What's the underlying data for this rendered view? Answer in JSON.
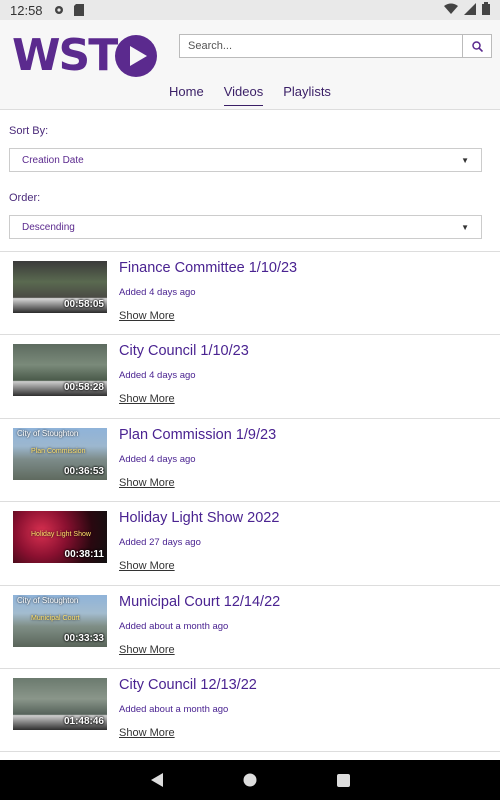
{
  "status": {
    "time": "12:58"
  },
  "brand": {
    "logo_text": "WSTO"
  },
  "search": {
    "placeholder": "Search..."
  },
  "nav": {
    "tabs": [
      "Home",
      "Videos",
      "Playlists"
    ],
    "active": "Videos"
  },
  "controls": {
    "sort_label": "Sort By:",
    "sort_value": "Creation Date",
    "order_label": "Order:",
    "order_value": "Descending"
  },
  "videos": [
    {
      "title": "Finance Committee 1/10/23",
      "added": "Added 4 days ago",
      "duration": "00:58:05",
      "more": "Show More",
      "caption": "",
      "subcaption": ""
    },
    {
      "title": "City Council 1/10/23",
      "added": "Added 4 days ago",
      "duration": "00:58:28",
      "more": "Show More",
      "caption": "",
      "subcaption": ""
    },
    {
      "title": "Plan Commission 1/9/23",
      "added": "Added 4 days ago",
      "duration": "00:36:53",
      "more": "Show More",
      "caption": "City of Stoughton",
      "subcaption": "Plan Commission"
    },
    {
      "title": "Holiday Light Show 2022",
      "added": "Added 27 days ago",
      "duration": "00:38:11",
      "more": "Show More",
      "caption": "",
      "subcaption": "Holiday Light Show"
    },
    {
      "title": "Municipal Court 12/14/22",
      "added": "Added about a month ago",
      "duration": "00:33:33",
      "more": "Show More",
      "caption": "City of Stoughton",
      "subcaption": "Municipal Court"
    },
    {
      "title": "City Council 12/13/22",
      "added": "Added about a month ago",
      "duration": "01:48:46",
      "more": "Show More",
      "caption": "",
      "subcaption": ""
    }
  ],
  "colors": {
    "brand": "#5b2a8e",
    "link": "#4a2391"
  }
}
